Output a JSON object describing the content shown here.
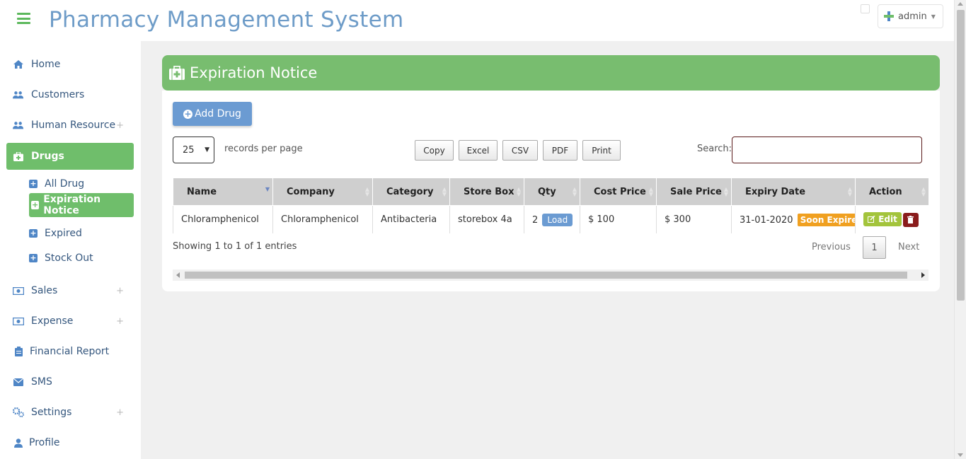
{
  "header": {
    "title": "Pharmacy Management System",
    "user": "admin"
  },
  "sidebar": {
    "items": [
      {
        "label": "Home",
        "icon": "home-icon"
      },
      {
        "label": "Customers",
        "icon": "users-icon"
      },
      {
        "label": "Human Resource",
        "icon": "users-icon",
        "expandable": true
      },
      {
        "label": "Drugs",
        "icon": "medkit-icon",
        "active": true
      },
      {
        "label": "Sales",
        "icon": "money-icon",
        "expandable": true
      },
      {
        "label": "Expense",
        "icon": "money-icon",
        "expandable": true
      },
      {
        "label": "Financial Report",
        "icon": "clipboard-icon"
      },
      {
        "label": "SMS",
        "icon": "envelope-icon"
      },
      {
        "label": "Settings",
        "icon": "cogs-icon",
        "expandable": true
      },
      {
        "label": "Profile",
        "icon": "user-icon"
      }
    ],
    "sub_items": [
      {
        "label": "All Drug"
      },
      {
        "label": "Expiration Notice",
        "active": true
      },
      {
        "label": "Expired"
      },
      {
        "label": "Stock Out"
      }
    ],
    "plus_symbol": "+"
  },
  "panel": {
    "title": "Expiration Notice",
    "add_button": "Add Drug"
  },
  "controls": {
    "page_length": "25",
    "records_label": "records per page",
    "export_buttons": [
      "Copy",
      "Excel",
      "CSV",
      "PDF",
      "Print"
    ],
    "search_label": "Search:",
    "search_value": ""
  },
  "table": {
    "columns": [
      "Name",
      "Company",
      "Category",
      "Store Box",
      "Qty",
      "Cost Price",
      "Sale Price",
      "Expiry Date",
      "Action"
    ],
    "rows": [
      {
        "name": "Chloramphenicol",
        "company": "Chloramphenicol",
        "category": "Antibacteria",
        "store_box": "storebox 4a",
        "qty": "2",
        "qty_button": "Load",
        "cost_price": "$ 100",
        "sale_price": "$ 300",
        "expiry_date": "31-01-2020",
        "expiry_badge": "Soon Expire",
        "edit_label": "Edit"
      }
    ]
  },
  "footer": {
    "info": "Showing 1 to 1 of 1 entries",
    "prev": "Previous",
    "page": "1",
    "next": "Next"
  },
  "colors": {
    "accent_green": "#78bd6f",
    "title_blue": "#6e9cc8",
    "button_blue": "#6b9bd2",
    "warning_orange": "#f0a020",
    "edit_green": "#a3c43c",
    "delete_red": "#8a1c1c"
  }
}
